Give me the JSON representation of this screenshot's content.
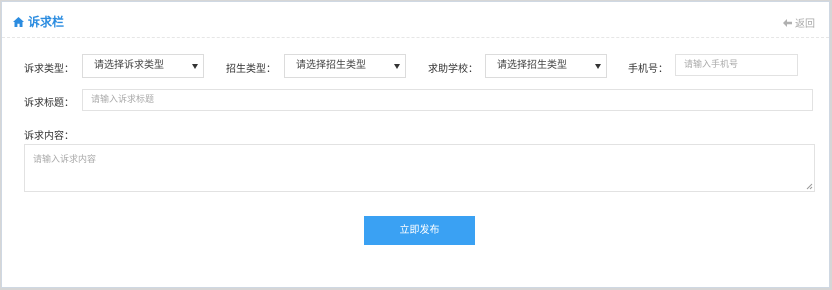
{
  "header": {
    "title": "诉求栏",
    "back_label": "返回"
  },
  "form": {
    "appeal_type_label": "诉求类型：",
    "appeal_type_value": "请选择诉求类型",
    "enroll_type_label": "招生类型：",
    "enroll_type_value": "请选择招生类型",
    "school_label": "求助学校：",
    "school_value": "请选择招生类型",
    "phone_label": "手机号：",
    "phone_placeholder": "请输入手机号",
    "subject_label": "诉求标题：",
    "subject_placeholder": "请输入诉求标题",
    "content_label": "诉求内容：",
    "content_placeholder": "请输入诉求内容",
    "submit_label": "立即发布"
  },
  "colors": {
    "accent": "#2b8ce0",
    "button": "#3aa1f3"
  },
  "icons": {
    "title": "home-icon",
    "back": "arrow-left-icon",
    "select": "caret-down-icon"
  }
}
